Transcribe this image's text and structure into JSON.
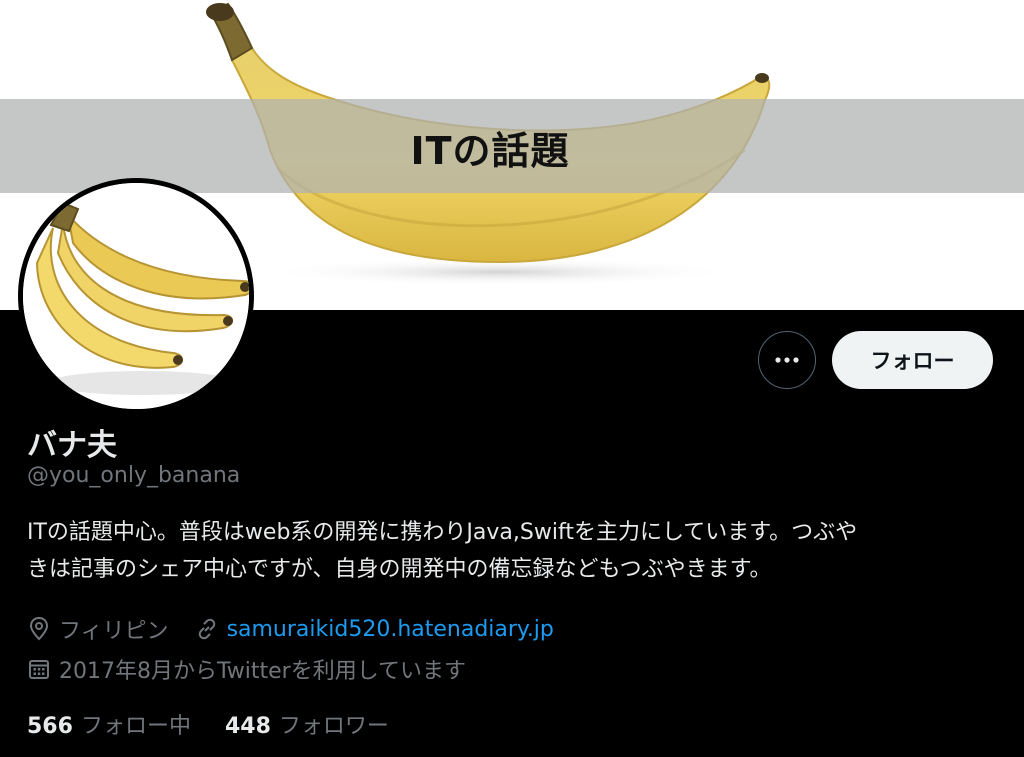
{
  "banner": {
    "title": "ITの話題",
    "background_color": "#ffffff",
    "strip_color": "#afb2b2"
  },
  "avatar": {
    "image": "banana-bunch"
  },
  "actions": {
    "more_icon": "ellipsis-icon",
    "follow_label": "フォロー"
  },
  "profile": {
    "display_name": "バナ夫",
    "handle": "@you_only_banana",
    "bio_line1": "ITの話題中心。普段はweb系の開発に携わりJava,Swiftを主力にしています。つぶや",
    "bio_line2": "きは記事のシェア中心ですが、自身の開発中の備忘録などもつぶやきます。",
    "location": "フィリピン",
    "website": "samuraikid520.hatenadiary.jp",
    "joined": "2017年8月からTwitterを利用しています"
  },
  "stats": {
    "following_count": "566",
    "following_label": "フォロー中",
    "followers_count": "448",
    "followers_label": "フォロワー"
  },
  "colors": {
    "background": "#000000",
    "text_primary": "#e7e9ea",
    "text_secondary": "#71767b",
    "link": "#1d9bf0",
    "follow_button_bg": "#eff3f4"
  }
}
